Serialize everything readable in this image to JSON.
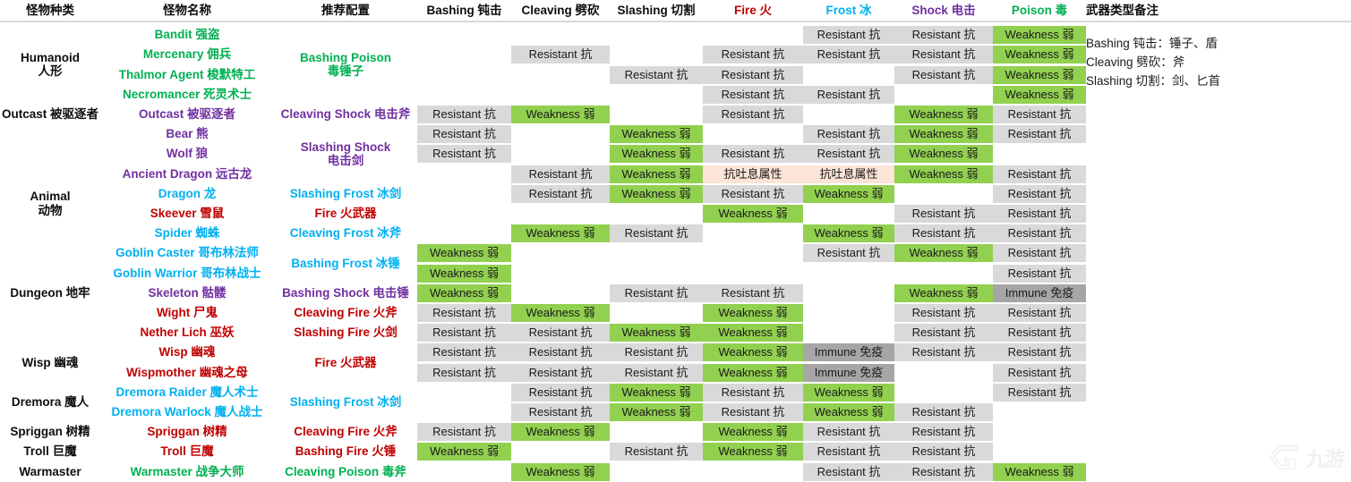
{
  "colors": {
    "resistant_bg": "#d9d9d9",
    "weakness_bg": "#92d050",
    "immune_bg": "#a6a6a6",
    "breath_bg": "#fce4d6",
    "fire": "#c00000",
    "frost": "#00b0f0",
    "shock": "#7030a0",
    "poison": "#00b050",
    "neutral": "#0d0d0d"
  },
  "header": {
    "columns": [
      {
        "key": "kind",
        "label": "怪物种类",
        "color": "#0d0d0d"
      },
      {
        "key": "name",
        "label": "怪物名称",
        "color": "#0d0d0d"
      },
      {
        "key": "build",
        "label": "推荐配置",
        "color": "#0d0d0d"
      },
      {
        "key": "bashing",
        "label": "Bashing 钝击",
        "color": "#0d0d0d"
      },
      {
        "key": "cleaving",
        "label": "Cleaving 劈砍",
        "color": "#0d0d0d"
      },
      {
        "key": "slashing",
        "label": "Slashing 切割",
        "color": "#0d0d0d"
      },
      {
        "key": "fire",
        "label": "Fire 火",
        "color": "#c00000"
      },
      {
        "key": "frost",
        "label": "Frost 冰",
        "color": "#00b0f0"
      },
      {
        "key": "shock",
        "label": "Shock 电击",
        "color": "#7030a0"
      },
      {
        "key": "poison",
        "label": "Poison 毒",
        "color": "#00b050"
      },
      {
        "key": "notes",
        "label": "武器类型备注",
        "color": "#0d0d0d"
      }
    ]
  },
  "values": {
    "R": "Resistant 抗",
    "W": "Weakness 弱",
    "I": "Immune 免疫",
    "B": "抗吐息属性",
    "": ""
  },
  "kinds": [
    {
      "label": "Humanoid\n人形",
      "color": "#0d0d0d",
      "rows": [
        0,
        3
      ]
    },
    {
      "label": "Outcast 被驱逐者",
      "color": "#0d0d0d",
      "rows": [
        4,
        4
      ]
    },
    {
      "label": "Animal\n动物",
      "color": "#0d0d0d",
      "rows": [
        5,
        12
      ]
    },
    {
      "label": "Dungeon 地牢",
      "color": "#0d0d0d",
      "rows": [
        13,
        13
      ]
    },
    {
      "label": "Wisp 幽魂",
      "color": "#0d0d0d",
      "rows": [
        16,
        17
      ]
    },
    {
      "label": "Dremora 魔人",
      "color": "#0d0d0d",
      "rows": [
        18,
        19
      ]
    },
    {
      "label": "Spriggan 树精",
      "color": "#0d0d0d",
      "rows": [
        20,
        20
      ]
    },
    {
      "label": "Troll 巨魔",
      "color": "#0d0d0d",
      "rows": [
        21,
        21
      ]
    },
    {
      "label": "Warmaster",
      "color": "#0d0d0d",
      "rows": [
        22,
        22
      ]
    }
  ],
  "monsters": [
    {
      "name": "Bandit 强盗",
      "color": "#00b050",
      "row": 0
    },
    {
      "name": "Mercenary 佣兵",
      "color": "#00b050",
      "row": 1
    },
    {
      "name": "Thalmor Agent 梭默特工",
      "color": "#00b050",
      "row": 2
    },
    {
      "name": "Necromancer 死灵术士",
      "color": "#00b050",
      "row": 3
    },
    {
      "name": "Outcast 被驱逐者",
      "color": "#7030a0",
      "row": 4
    },
    {
      "name": "Bear 熊",
      "color": "#7030a0",
      "row": 5
    },
    {
      "name": "Wolf 狼",
      "color": "#7030a0",
      "row": 6
    },
    {
      "name": "Ancient Dragon 远古龙",
      "color": "#7030a0",
      "row": 7
    },
    {
      "name": "Dragon 龙",
      "color": "#00b0f0",
      "row": 8
    },
    {
      "name": "Skeever 雪鼠",
      "color": "#c00000",
      "row": 9
    },
    {
      "name": "Spider 蜘蛛",
      "color": "#00b0f0",
      "row": 10
    },
    {
      "name": "Goblin Caster 哥布林法师",
      "color": "#00b0f0",
      "row": 11
    },
    {
      "name": "Goblin Warrior 哥布林战士",
      "color": "#00b0f0",
      "row": 12
    },
    {
      "name": "Skeleton 骷髅",
      "color": "#7030a0",
      "row": 13
    },
    {
      "name": "Wight 尸鬼",
      "color": "#c00000",
      "row": 14
    },
    {
      "name": "Nether Lich 巫妖",
      "color": "#c00000",
      "row": 15
    },
    {
      "name": "Wisp 幽魂",
      "color": "#c00000",
      "row": 16
    },
    {
      "name": "Wispmother 幽魂之母",
      "color": "#c00000",
      "row": 17
    },
    {
      "name": "Dremora Raider 魔人术士",
      "color": "#00b0f0",
      "row": 18
    },
    {
      "name": "Dremora Warlock 魔人战士",
      "color": "#00b0f0",
      "row": 19
    },
    {
      "name": "Spriggan 树精",
      "color": "#c00000",
      "row": 20
    },
    {
      "name": "Troll 巨魔",
      "color": "#c00000",
      "row": 21
    },
    {
      "name": "Warmaster 战争大师",
      "color": "#00b050",
      "row": 22
    }
  ],
  "builds": [
    {
      "label": "Bashing Poison\n毒锤子",
      "color": "#00b050",
      "rows": [
        0,
        3
      ]
    },
    {
      "label": "Cleaving Shock 电击斧",
      "color": "#7030a0",
      "rows": [
        4,
        4
      ]
    },
    {
      "label": "Slashing Shock\n电击剑",
      "color": "#7030a0",
      "rows": [
        5,
        7
      ]
    },
    {
      "label": "Slashing Frost 冰剑",
      "color": "#00b0f0",
      "rows": [
        8,
        8
      ]
    },
    {
      "label": "Fire 火武器",
      "color": "#c00000",
      "rows": [
        9,
        9
      ]
    },
    {
      "label": "Cleaving Frost 冰斧",
      "color": "#00b0f0",
      "rows": [
        10,
        10
      ]
    },
    {
      "label": "Bashing Frost 冰锤",
      "color": "#00b0f0",
      "rows": [
        11,
        12
      ]
    },
    {
      "label": "Bashing Shock 电击锤",
      "color": "#7030a0",
      "rows": [
        13,
        13
      ]
    },
    {
      "label": "Cleaving Fire 火斧",
      "color": "#c00000",
      "rows": [
        14,
        14
      ]
    },
    {
      "label": "Slashing Fire 火剑",
      "color": "#c00000",
      "rows": [
        15,
        15
      ]
    },
    {
      "label": "Fire 火武器",
      "color": "#c00000",
      "rows": [
        16,
        17
      ]
    },
    {
      "label": "Slashing Frost 冰剑",
      "color": "#00b0f0",
      "rows": [
        18,
        19
      ]
    },
    {
      "label": "Cleaving Fire 火斧",
      "color": "#c00000",
      "rows": [
        20,
        20
      ]
    },
    {
      "label": "Bashing Fire 火锤",
      "color": "#c00000",
      "rows": [
        21,
        21
      ]
    },
    {
      "label": "Cleaving Poison 毒斧",
      "color": "#00b050",
      "rows": [
        22,
        22
      ]
    }
  ],
  "matrix_columns": [
    "bashing",
    "cleaving",
    "slashing",
    "fire",
    "frost",
    "shock",
    "poison"
  ],
  "matrix": [
    [
      "",
      "",
      "",
      "",
      "R",
      "R",
      "W"
    ],
    [
      "",
      "R",
      "",
      "R",
      "R",
      "R",
      "W"
    ],
    [
      "",
      "",
      "R",
      "R",
      "",
      "R",
      "W"
    ],
    [
      "",
      "",
      "",
      "R",
      "R",
      "",
      "W"
    ],
    [
      "R",
      "W",
      "",
      "R",
      "",
      "W",
      "R"
    ],
    [
      "R",
      "",
      "W",
      "",
      "R",
      "W",
      "R"
    ],
    [
      "R",
      "",
      "W",
      "R",
      "R",
      "W",
      ""
    ],
    [
      "",
      "R",
      "W",
      "B",
      "B",
      "W",
      "R"
    ],
    [
      "",
      "R",
      "W",
      "R",
      "W",
      "",
      "R"
    ],
    [
      "",
      "",
      "",
      "W",
      "",
      "R",
      "R"
    ],
    [
      "",
      "W",
      "R",
      "",
      "W",
      "R",
      "R"
    ],
    [
      "W",
      "",
      "",
      "",
      "R",
      "W",
      "R"
    ],
    [
      "W",
      "",
      "",
      "",
      "",
      "",
      "R"
    ],
    [
      "W",
      "",
      "R",
      "R",
      "",
      "W",
      "I"
    ],
    [
      "R",
      "W",
      "",
      "W",
      "",
      "R",
      "R"
    ],
    [
      "R",
      "R",
      "W",
      "W",
      "",
      "R",
      "R"
    ],
    [
      "R",
      "R",
      "R",
      "W",
      "I",
      "R",
      "R"
    ],
    [
      "R",
      "R",
      "R",
      "W",
      "I",
      "",
      "R"
    ],
    [
      "",
      "R",
      "W",
      "R",
      "W",
      "",
      "R"
    ],
    [
      "",
      "R",
      "W",
      "R",
      "W",
      "R",
      ""
    ],
    [
      "R",
      "W",
      "",
      "W",
      "R",
      "R",
      ""
    ],
    [
      "W",
      "",
      "R",
      "W",
      "R",
      "R",
      ""
    ],
    [
      "",
      "W",
      "",
      "",
      "R",
      "R",
      "W"
    ]
  ],
  "notes": {
    "lines": "Bashing 钝击：锤子、盾\nCleaving 劈砍：斧\nSlashing 切割：剑、匕首"
  },
  "watermark": {
    "text": "九游",
    "logo": "g-logo-icon"
  }
}
